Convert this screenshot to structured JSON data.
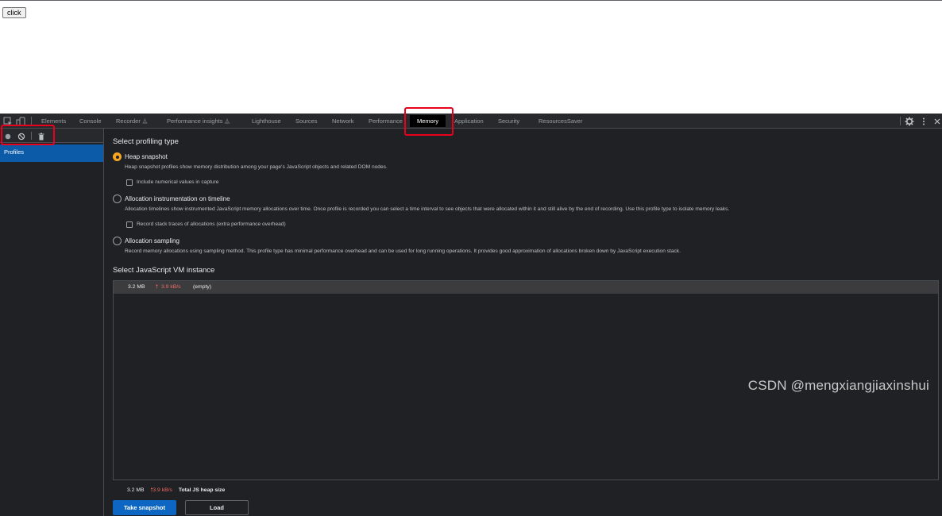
{
  "page": {
    "button_label": "click"
  },
  "devtools": {
    "tabs": [
      {
        "label": "Elements"
      },
      {
        "label": "Console"
      },
      {
        "label": "Recorder",
        "flask": "⏅"
      },
      {
        "label": "Performance insights",
        "flask": "⏅"
      },
      {
        "label": "Lighthouse"
      },
      {
        "label": "Sources"
      },
      {
        "label": "Network"
      },
      {
        "label": "Performance"
      },
      {
        "label": "Memory",
        "selected": true
      },
      {
        "label": "Application"
      },
      {
        "label": "Security"
      },
      {
        "label": "ResourcesSaver"
      }
    ],
    "sidebar": {
      "item": "Profiles"
    },
    "profiling": {
      "heading": "Select profiling type",
      "options": [
        {
          "title": "Heap snapshot",
          "description": "Heap snapshot profiles show memory distribution among your page's JavaScript objects and related DOM nodes.",
          "checkbox": "Include numerical values in capture",
          "selected": true
        },
        {
          "title": "Allocation instrumentation on timeline",
          "description": "Allocation timelines show instrumented JavaScript memory allocations over time. Once profile is recorded you can select a time interval to see objects that were allocated within it and still alive by the end of recording. Use this profile type to isolate memory leaks.",
          "checkbox": "Record stack traces of allocations (extra performance overhead)",
          "selected": false
        },
        {
          "title": "Allocation sampling",
          "description": "Record memory allocations using sampling method. This profile type has minimal performance overhead and can be used for long running operations. It provides good approximation of allocations broken down by JavaScript execution stack.",
          "selected": false
        }
      ]
    },
    "vm": {
      "heading": "Select JavaScript VM instance",
      "row": {
        "size": "3.2 MB",
        "rate": "3.9 kB/s",
        "name": "(empty)"
      }
    },
    "footer": {
      "size": "3.2 MB",
      "rate": "3.9 kB/s",
      "label": "Total JS heap size",
      "primary_button": "Take snapshot",
      "secondary_button": "Load"
    },
    "colors": {
      "accent": "#0c66c2",
      "highlight": "#e8001c",
      "radio_selected": "#f5a623",
      "rate": "#ee6a60"
    }
  },
  "watermark": "CSDN @mengxiangjiaxinshui"
}
